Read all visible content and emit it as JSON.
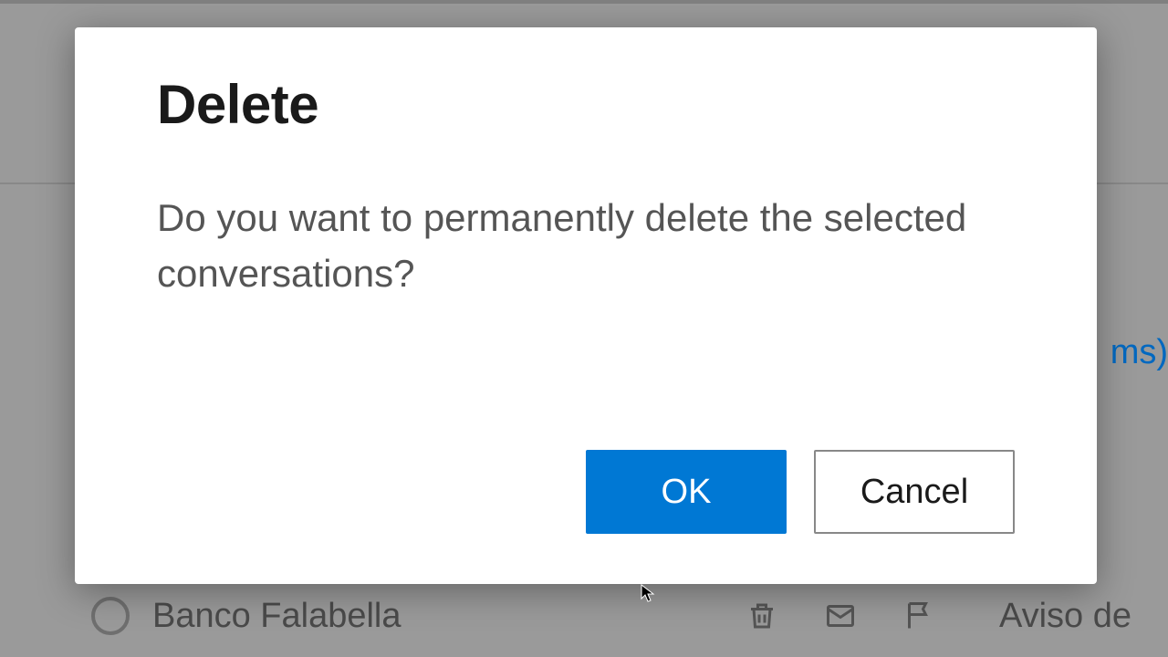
{
  "dialog": {
    "title": "Delete",
    "message": "Do you want to permanently delete the selected conversations?",
    "ok_label": "OK",
    "cancel_label": "Cancel"
  },
  "background": {
    "link_fragment": "ms)",
    "sender": "Banco Falabella",
    "subject_fragment": "Aviso de"
  }
}
